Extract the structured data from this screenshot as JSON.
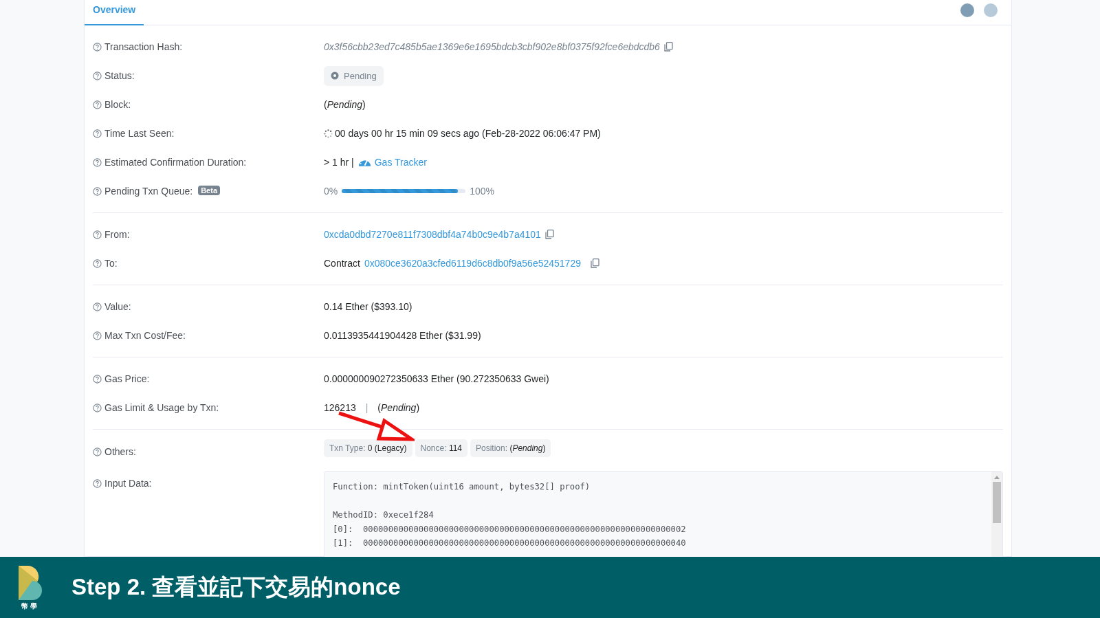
{
  "tabs": [
    {
      "label": "Overview",
      "selected": true
    }
  ],
  "sections": [
    [
      {
        "kind": "hash",
        "label": "Transaction Hash:",
        "value": "0x3f56cbb23ed7c485b5ae1369e6e1695bdcb3cbf902e8bf0375f92fce6ebdcdb6"
      },
      {
        "kind": "status",
        "label": "Status:",
        "value": "Pending"
      },
      {
        "kind": "text",
        "label": "Block:",
        "value": "(*Pending*)"
      },
      {
        "kind": "time",
        "label": "Time Last Seen:",
        "value": "00 days 00 hr 15 min 09 secs ago (Feb-28-2022 06:06:47 PM)"
      },
      {
        "kind": "duration",
        "label": "Estimated Confirmation Duration:",
        "value": "> 1 hr |",
        "link": "Gas Tracker"
      },
      {
        "kind": "queue",
        "label": "Pending Txn Queue:",
        "badge": "Beta",
        "start": "0%",
        "level": 0.94,
        "end": "100%"
      }
    ],
    [
      {
        "kind": "address",
        "label": "From:",
        "value": "0xcda0dbd7270e811f7308dbf4a74b0c9e4b7a4101"
      },
      {
        "kind": "address",
        "label": "To:",
        "prefix": "Contract",
        "value": "0x080ce3620a3cfed6119d6c8db0f9a56e52451729"
      }
    ],
    [
      {
        "kind": "text",
        "label": "Value:",
        "value": "0.14 Ether ($393.10)"
      },
      {
        "kind": "text",
        "label": "Max Txn Cost/Fee:",
        "value": "0.0113935441904428 Ether ($31.99)"
      }
    ],
    [
      {
        "kind": "text",
        "label": "Gas Price:",
        "value": "0.000000090272350633 Ether (90.272350633 Gwei)"
      },
      {
        "kind": "usage",
        "label": "Gas Limit & Usage by Txn:",
        "value": "126213",
        "separator": "|",
        "usage": "(*Pending*)"
      }
    ],
    [
      {
        "kind": "tags",
        "label": "Others:",
        "tags": [
          {
            "label": "Txn Type:",
            "value": "0 (Legacy)"
          },
          {
            "label": "Nonce:",
            "value": "114"
          },
          {
            "label": "Position:",
            "value": "(*Pending*)"
          }
        ]
      },
      {
        "kind": "input",
        "label": "Input Data:",
        "blocks": [
          [
            "Function: mintToken(uint16 amount, bytes32[] proof)"
          ],
          [
            "MethodID: 0xece1f284",
            "[0]:  0000000000000000000000000000000000000000000000000000000000000002",
            "[1]:  0000000000000000000000000000000000000000000000000000000000000040"
          ]
        ]
      }
    ]
  ],
  "caption": {
    "logo_text": "幣學",
    "title": "Step 2. 查看並記下交易的nonce"
  }
}
